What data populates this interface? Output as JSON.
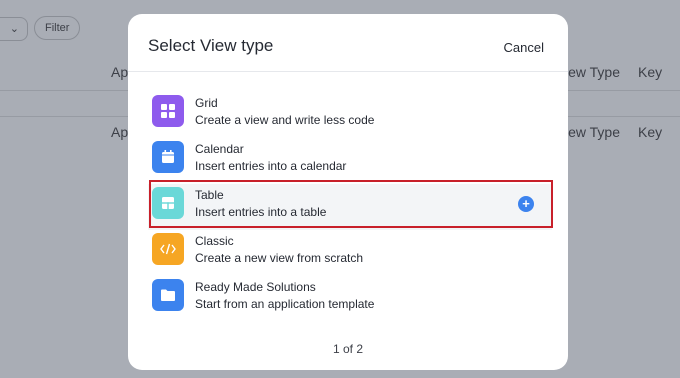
{
  "background": {
    "filter_label": "Filter",
    "headers": [
      "Ap",
      "iew Type",
      "Key"
    ],
    "row": [
      "Ap",
      "iew Type",
      "Key"
    ]
  },
  "modal": {
    "title": "Select View type",
    "cancel_label": "Cancel",
    "options": [
      {
        "title": "Grid",
        "description": "Create a view and write less code",
        "icon": "grid-icon",
        "color": "#8e5bed"
      },
      {
        "title": "Calendar",
        "description": "Insert entries into a calendar",
        "icon": "calendar-icon",
        "color": "#3c83ee"
      },
      {
        "title": "Table",
        "description": "Insert entries into a table",
        "icon": "table-icon",
        "color": "#6ad8d8",
        "selected": true
      },
      {
        "title": "Classic",
        "description": "Create a new view from scratch",
        "icon": "code-icon",
        "color": "#f6a623"
      },
      {
        "title": "Ready Made Solutions",
        "description": "Start from an application template",
        "icon": "folder-icon",
        "color": "#3c83ee"
      }
    ],
    "pagination": "1 of 2"
  }
}
